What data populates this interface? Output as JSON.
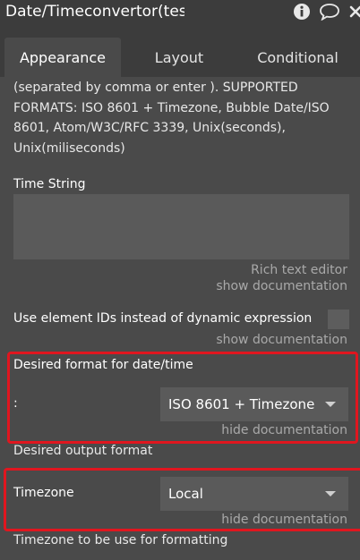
{
  "window": {
    "title": "Date/Timeconvertor(test"
  },
  "icons": {
    "info": "info-icon",
    "comment": "comment-icon",
    "close": "close-icon"
  },
  "tabs": [
    {
      "label": "Appearance",
      "active": true
    },
    {
      "label": "Layout",
      "active": false
    },
    {
      "label": "Conditional",
      "active": false
    }
  ],
  "description": "(separated by comma or enter ). SUPPORTED FORMATS: ISO 8601 + Timezone, Bubble Date/ISO 8601, Atom/W3C/RFC 3339, Unix(seconds), Unix(miliseconds)",
  "time_string": {
    "label": "Time String",
    "value": "",
    "rich_text_label": "Rich text editor",
    "doc_link": "show documentation"
  },
  "element_ids": {
    "label": "Use element IDs instead of dynamic expression",
    "checked": false,
    "doc_link": "show documentation"
  },
  "desired_format": {
    "label": "Desired format for date/time",
    "colon": ":",
    "selected": "ISO 8601 + Timezone",
    "doc_link": "hide documentation",
    "doc_text": "Desired output format"
  },
  "timezone": {
    "label": "Timezone",
    "selected": "Local",
    "doc_link": "hide documentation",
    "doc_text": "Timezone to be use for formatting"
  },
  "colors": {
    "panel": "#4a4a4a",
    "header": "#3c3c3c",
    "field": "#5a5a5a",
    "highlight": "#e0161f",
    "muted_text": "#a9a9a9"
  }
}
